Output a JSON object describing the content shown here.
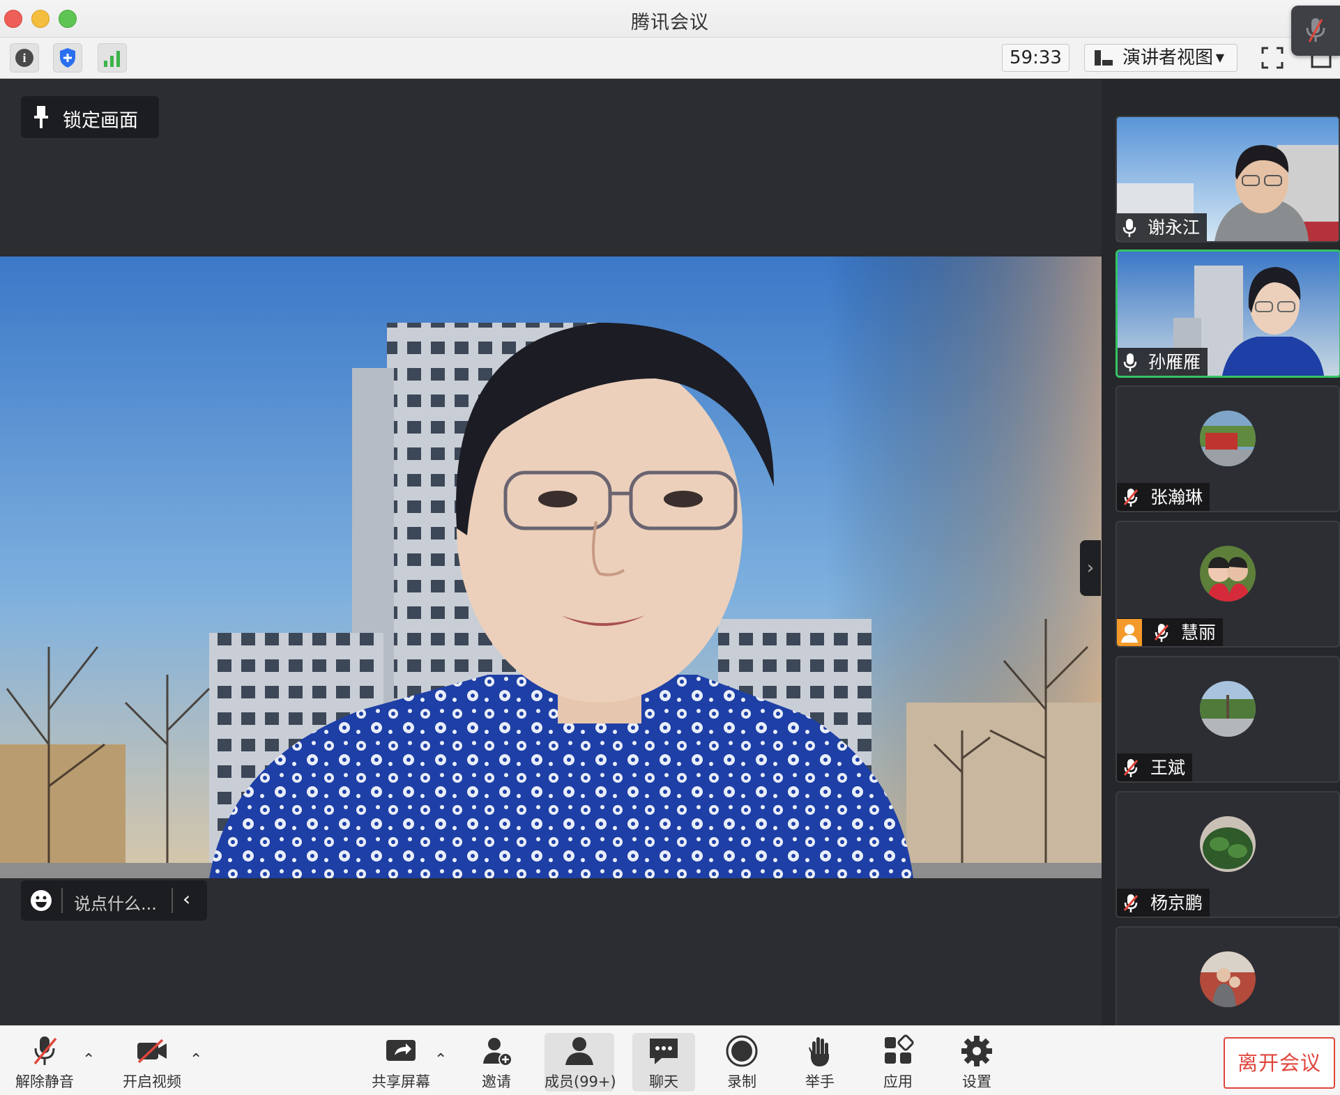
{
  "window": {
    "title": "腾讯会议"
  },
  "toolbar": {
    "timer": "59:33",
    "view_mode": "演讲者视图"
  },
  "stage": {
    "lock_view_label": "锁定画面",
    "chat_placeholder": "说点什么..."
  },
  "participants": [
    {
      "name": "谢永江",
      "mic": "on",
      "video": true
    },
    {
      "name": "孙雁雁",
      "mic": "on",
      "video": true,
      "speaking": true
    },
    {
      "name": "张瀚琳",
      "mic": "muted",
      "video": false
    },
    {
      "name": "慧丽",
      "mic": "muted",
      "video": false,
      "host_badge": true
    },
    {
      "name": "王斌",
      "mic": "muted",
      "video": false
    },
    {
      "name": "杨京鹏",
      "mic": "muted",
      "video": false
    },
    {
      "name": "",
      "mic": "",
      "video": false
    }
  ],
  "controls": {
    "unmute": "解除静音",
    "start_video": "开启视频",
    "share_screen": "共享屏幕",
    "invite": "邀请",
    "members": "成员(99+)",
    "chat": "聊天",
    "record": "录制",
    "raise_hand": "举手",
    "apps": "应用",
    "settings": "设置",
    "leave": "离开会议"
  },
  "colors": {
    "accent_green": "#35c463",
    "danger_red": "#e0463c",
    "shield_blue": "#2a6ff0"
  },
  "icons": [
    "info-icon",
    "shield-icon",
    "signal-icon",
    "pin-icon",
    "emoji-icon",
    "mic-icon",
    "mic-muted-icon",
    "video-off-icon",
    "share-icon",
    "invite-icon",
    "members-icon",
    "chat-icon",
    "record-icon",
    "hand-icon",
    "apps-icon",
    "gear-icon",
    "fullscreen-icon",
    "layout-icon"
  ]
}
